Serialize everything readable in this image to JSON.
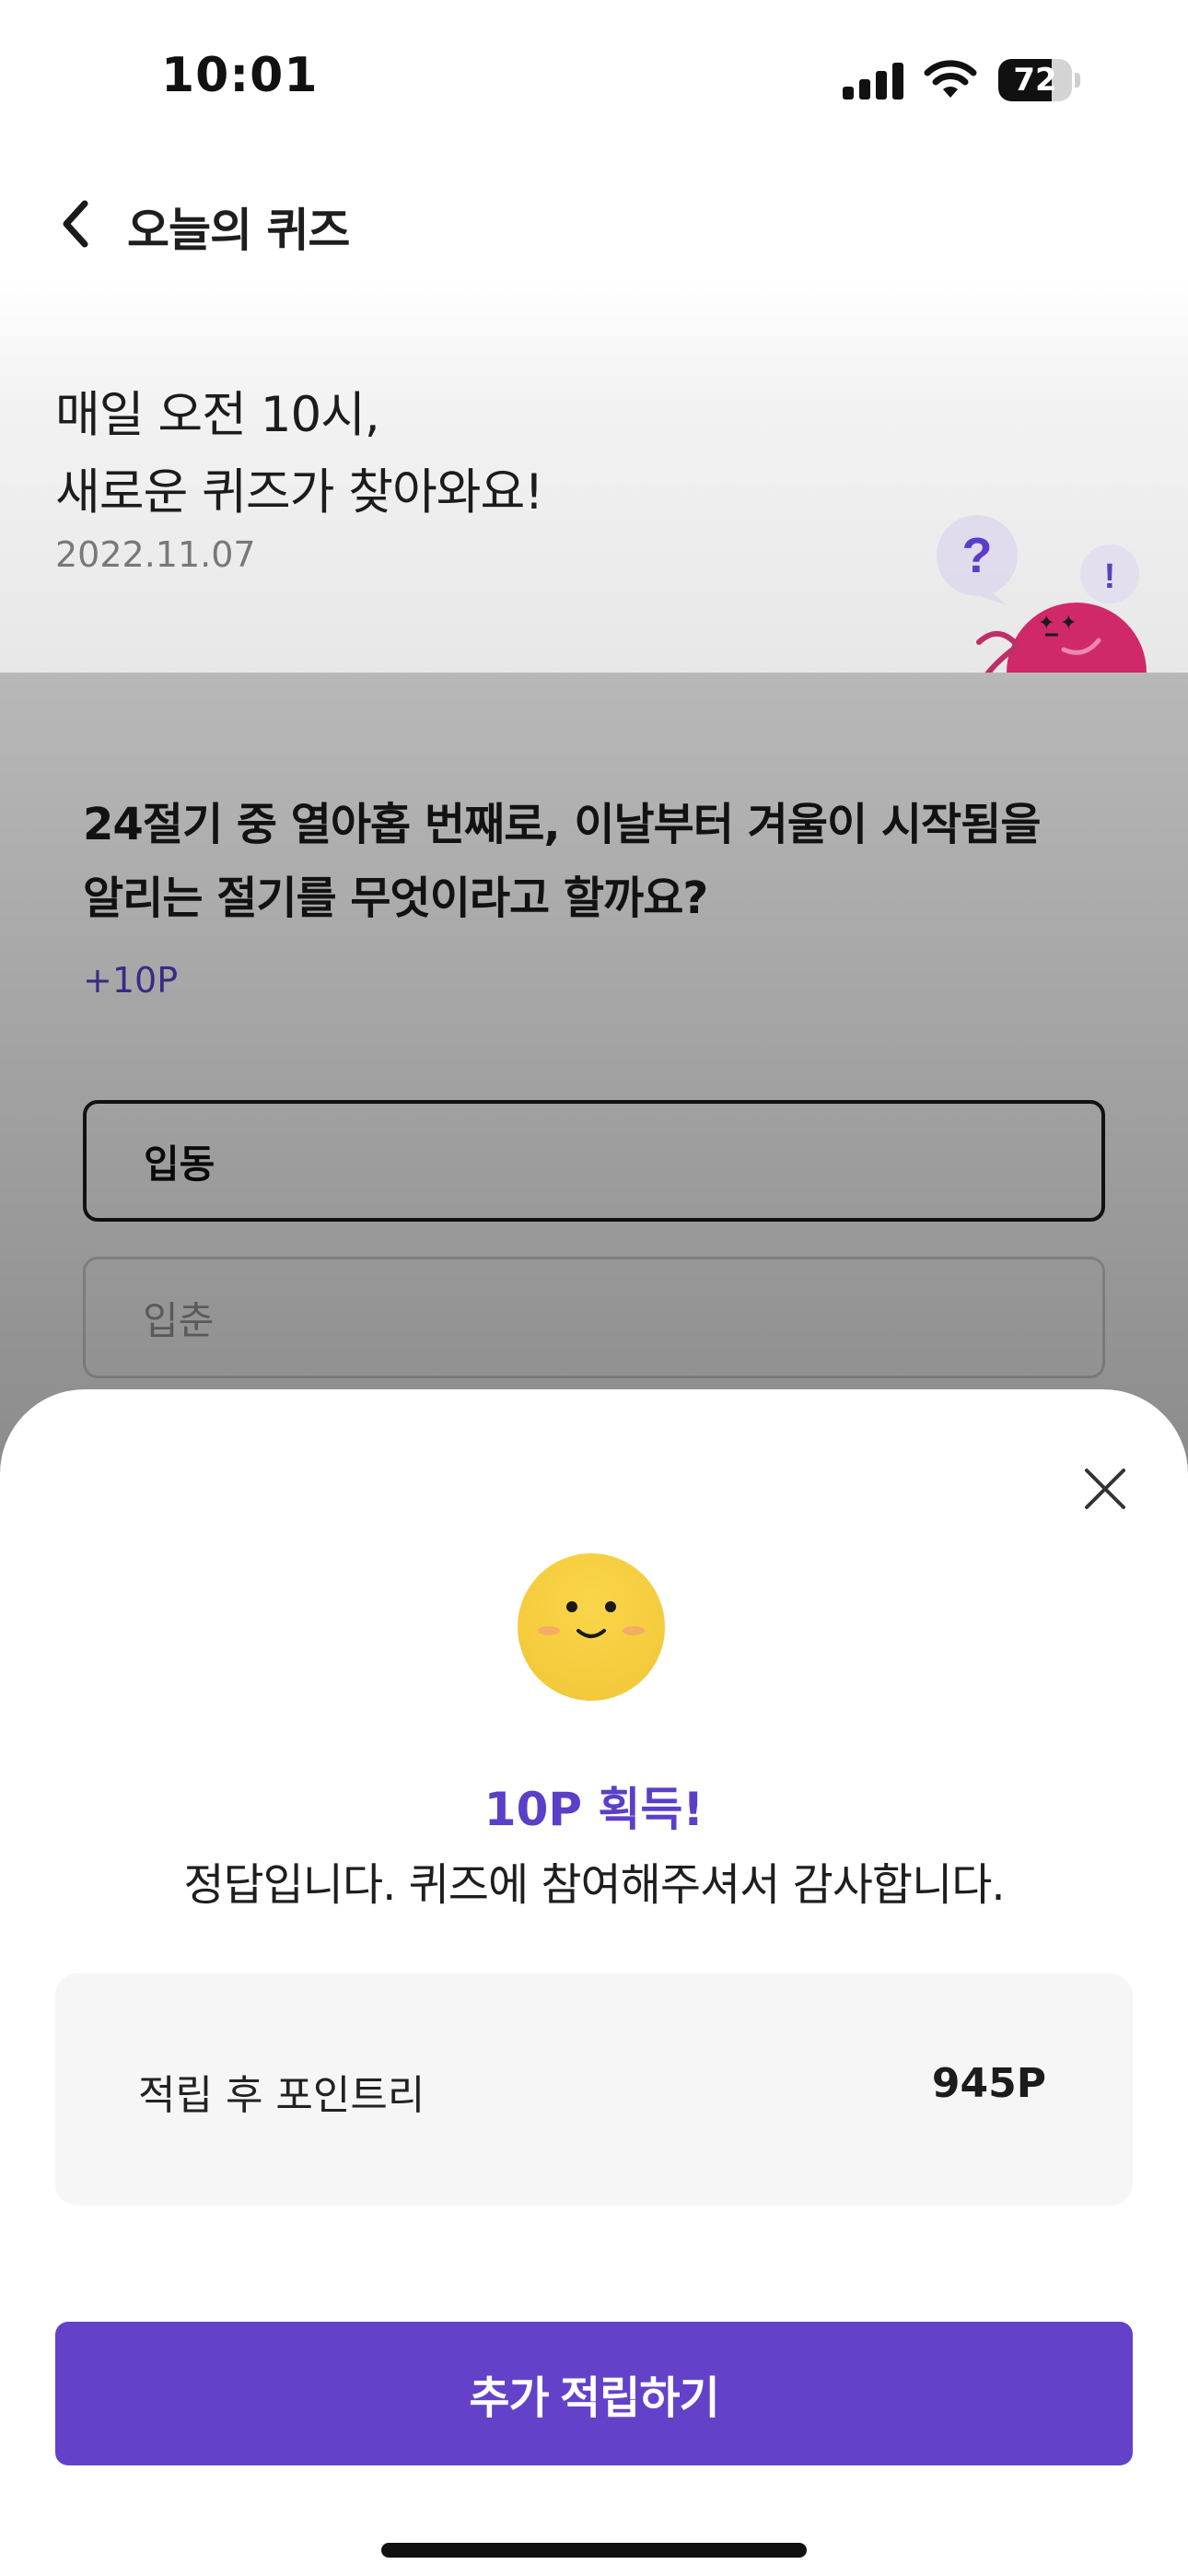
{
  "status_bar": {
    "time": "10:01",
    "battery": "72",
    "battery_level": 0.72
  },
  "header": {
    "back_icon": "chevron-left-icon",
    "title": "오늘의 퀴즈"
  },
  "hero": {
    "line1": "매일 오전 10시,",
    "line2": "새로운 퀴즈가 찾아와요!",
    "date": "2022.11.07",
    "mascot_question": "?",
    "mascot_exclaim": "!"
  },
  "quiz": {
    "question_line1": "24절기 중 열아홉 번째로, 이날부터 겨울이 시작됨을",
    "question_line2": "알리는 절기를 무엇이라고 할까요?",
    "points": "+10P",
    "options": [
      {
        "label": "입동",
        "selected": true
      },
      {
        "label": "입춘",
        "selected": false
      }
    ]
  },
  "result_sheet": {
    "close_icon": "close-icon",
    "reward_title": "10P 획득!",
    "message": "정답입니다. 퀴즈에 참여해주셔서 감사합니다.",
    "points_label": "적립 후 포인트리",
    "points_value": "945P",
    "cta_label": "추가 적립하기"
  },
  "colors": {
    "accent": "#6342c9",
    "accent_text": "#5b3fc8",
    "mascot": "#d42a6b",
    "emoji": "#f5cf3a"
  }
}
